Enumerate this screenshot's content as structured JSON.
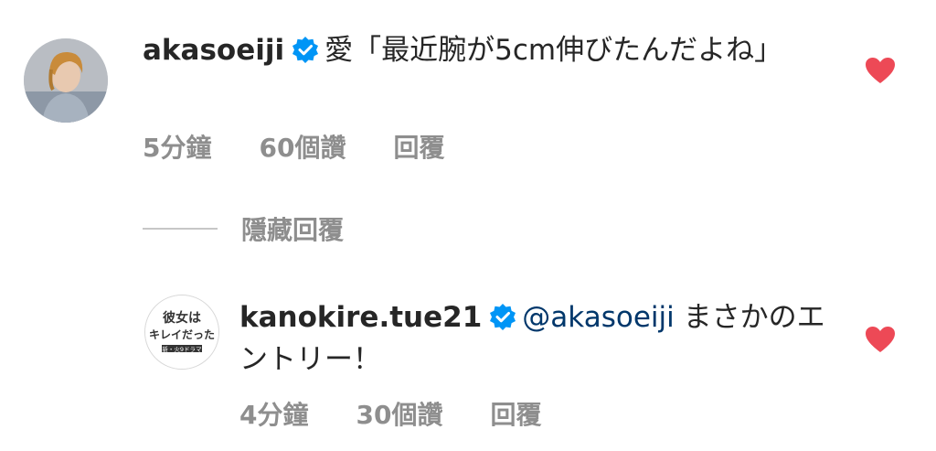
{
  "comments": [
    {
      "username": "akasoeiji",
      "verified": true,
      "text": "愛「最近腕が5cm伸びたんだよね」",
      "time": "5分鐘",
      "likes": "60個讚",
      "reply_label": "回覆",
      "liked": true
    },
    {
      "username": "kanokire.tue21",
      "verified": true,
      "mention": "@akasoeiji",
      "text": "まさかのエントリー！",
      "time": "4分鐘",
      "likes": "30個讚",
      "reply_label": "回覆",
      "liked": true,
      "avatar_logo_text": "彼女はキレイだった 新・火9ドラマ"
    }
  ],
  "hide_replies_label": "隱藏回覆",
  "colors": {
    "heart": "#ed4956",
    "verified": "#0095f6",
    "mention": "#00376b",
    "meta": "#8e8e8e"
  }
}
